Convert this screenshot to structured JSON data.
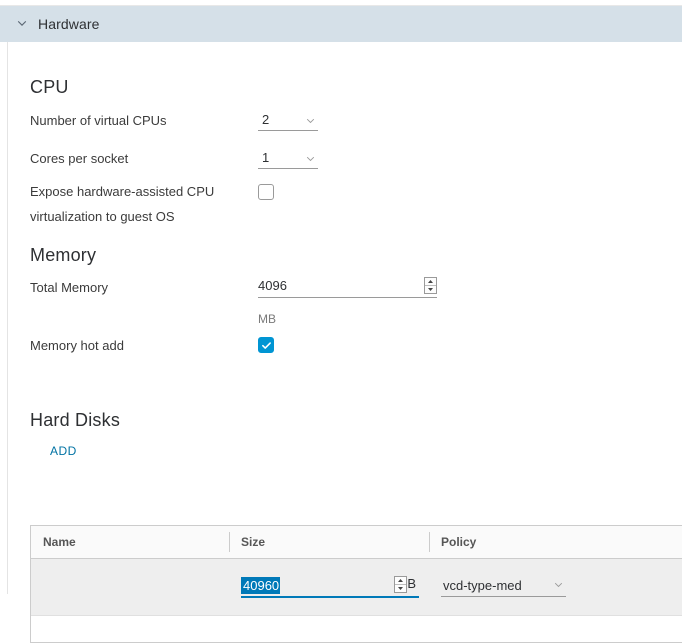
{
  "section": {
    "title": "Hardware",
    "collapse_icon": "chevron-down-icon"
  },
  "cpu": {
    "heading": "CPU",
    "fields": [
      {
        "label": "Number of virtual CPUs",
        "value": "2",
        "icon": "chevron-down-icon"
      },
      {
        "label": "Cores per socket",
        "value": "1",
        "icon": "chevron-down-icon"
      }
    ],
    "expose_virtualization": {
      "label_line1": "Expose hardware-assisted CPU",
      "label_line2": "virtualization to guest OS",
      "checked": false
    }
  },
  "memory": {
    "heading": "Memory",
    "total_memory": {
      "label": "Total Memory",
      "value": "4096",
      "unit": "MB",
      "spinner_icon": "spinner-updown-icon"
    },
    "hot_add": {
      "label": "Memory hot add",
      "checked": true
    }
  },
  "hard_disks": {
    "heading": "Hard Disks",
    "add_label": "ADD",
    "columns": [
      "Name",
      "Size",
      "Policy"
    ],
    "rows": [
      {
        "name": "",
        "size_value": "40960",
        "size_unit": "B",
        "policy": "vcd-type-med",
        "policy_icon": "chevron-down-icon",
        "spinner_icon": "spinner-updown-icon"
      }
    ]
  },
  "colors": {
    "header_bg": "#d5e0e8",
    "accent": "#0079b8",
    "checkbox_on": "#0095d3",
    "link": "#0072a3",
    "row_selected": "#eeeeee"
  }
}
